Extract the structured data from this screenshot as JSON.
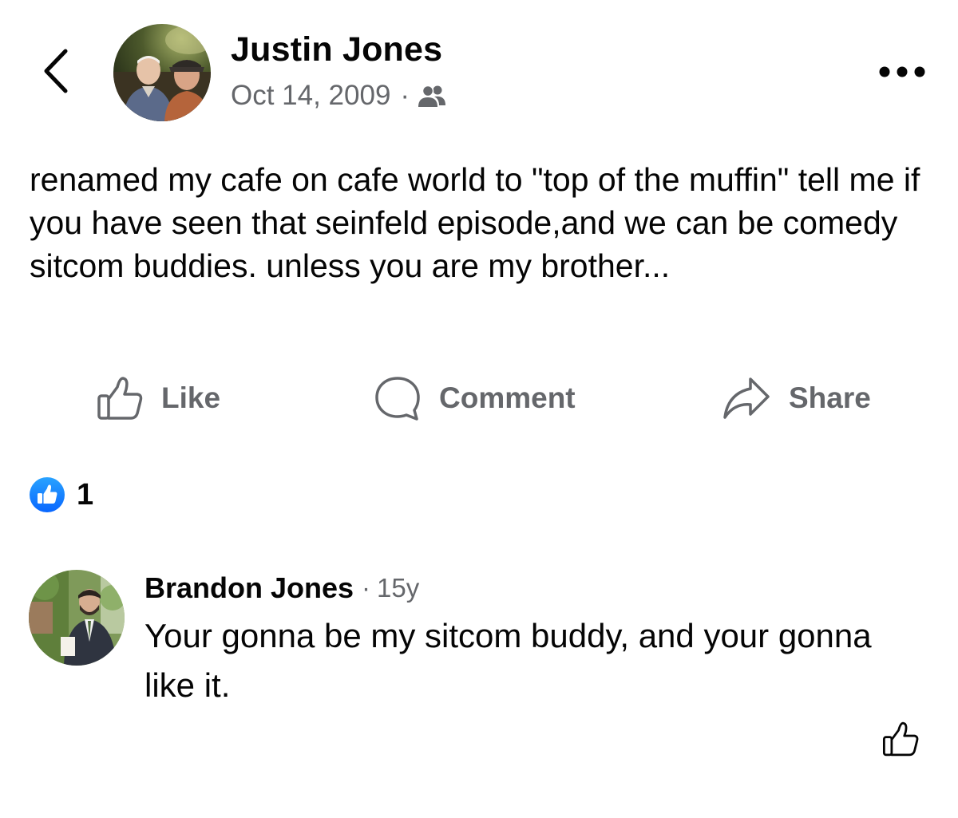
{
  "post": {
    "author_name": "Justin Jones",
    "date": "Oct 14, 2009",
    "separator": "·",
    "audience_icon": "friends-icon",
    "text": "renamed my cafe on cafe world to \"top of the muffin\" tell me if you have seen that seinfeld episode,and we can be comedy sitcom buddies. unless you are my brother..."
  },
  "header": {
    "back_icon": "chevron-left-icon",
    "more_icon": "more-horizontal-icon"
  },
  "actions": {
    "like_label": "Like",
    "comment_label": "Comment",
    "share_label": "Share"
  },
  "reactions": {
    "icon": "like-reaction-icon",
    "count": "1"
  },
  "comment": {
    "author_name": "Brandon Jones",
    "separator": "·",
    "time": "15y",
    "text": "Your gonna be my sitcom buddy, and your gonna like it.",
    "like_icon": "thumbs-up-outline-icon"
  },
  "colors": {
    "primary_text": "#050505",
    "secondary_text": "#65676b",
    "facebook_blue": "#1877f2",
    "background": "#ffffff"
  }
}
